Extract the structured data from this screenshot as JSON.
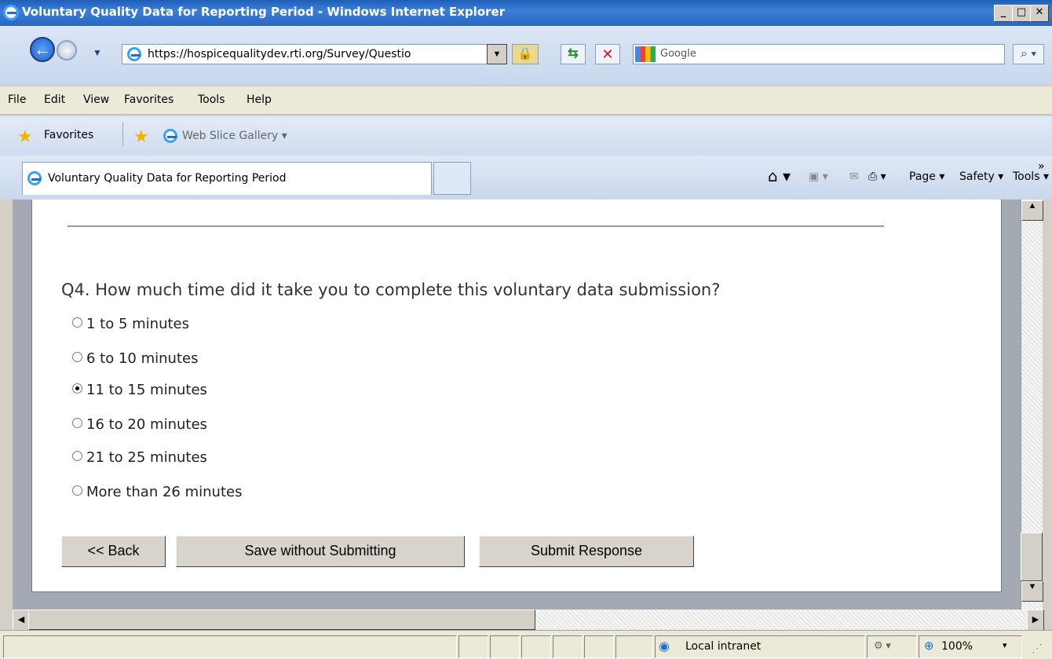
{
  "window": {
    "title": "Voluntary Quality Data for Reporting Period - Windows Internet Explorer",
    "controls": [
      "_",
      "□",
      "✕"
    ]
  },
  "address": {
    "url": "https://hospicequalitydev.rti.org/Survey/Questio",
    "search_placeholder": "Google"
  },
  "menu": [
    "File",
    "Edit",
    "View",
    "Favorites",
    "Tools",
    "Help"
  ],
  "favorites_bar": {
    "favorites_label": "Favorites",
    "web_slice_label": "Web Slice Gallery ▾"
  },
  "tab": {
    "title": "Voluntary Quality Data for Reporting Period"
  },
  "commandbar": {
    "page": "Page ▾",
    "safety": "Safety ▾",
    "tools": "Tools ▾",
    "overflow": "»"
  },
  "survey": {
    "question": "Q4. How much time did it take you to complete this voluntary data submission?",
    "options": [
      "1 to 5 minutes",
      "6 to 10 minutes",
      "11 to 15 minutes",
      "16 to 20 minutes",
      "21 to 25 minutes",
      "More than 26 minutes"
    ],
    "selected_option": "11 to 15 minutes",
    "buttons": {
      "back": "<< Back",
      "save": "Save without Submitting",
      "submit": "Submit Response"
    }
  },
  "status": {
    "zone": "Local intranet",
    "zoom": "100%"
  }
}
